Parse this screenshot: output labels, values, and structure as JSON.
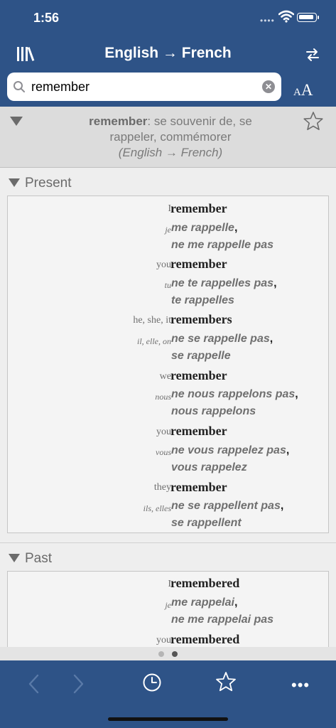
{
  "status": {
    "time": "1:56",
    "signal": "••••"
  },
  "nav": {
    "title": "English → French"
  },
  "search": {
    "value": "remember"
  },
  "font_size_button": {
    "small": "A",
    "large": "A"
  },
  "entry": {
    "word": "remember",
    "line1_rest": ": se souvenir de, se",
    "line2": "rappeler, commémorer",
    "direction": "(English → French)"
  },
  "sections": [
    {
      "label": "Present",
      "rows": [
        {
          "pronoun": "I",
          "english": "remember",
          "fr_pronoun": "je",
          "fr_line1": "me rappelle",
          "fr_line2": "ne me rappelle pas"
        },
        {
          "pronoun": "you",
          "english": "remember",
          "fr_pronoun": "tu",
          "fr_line1": "ne te rappelles pas",
          "fr_line2": "te rappelles"
        },
        {
          "pronoun": "he, she, it",
          "english": "remembers",
          "fr_pronoun": "il, elle, on",
          "fr_line1": "ne se rappelle pas",
          "fr_line2": "se rappelle"
        },
        {
          "pronoun": "we",
          "english": "remember",
          "fr_pronoun": "nous",
          "fr_line1": "ne nous rappelons pas",
          "fr_line2": "nous rappelons"
        },
        {
          "pronoun": "you",
          "english": "remember",
          "fr_pronoun": "vous",
          "fr_line1": "ne vous rappelez pas",
          "fr_line2": "vous rappelez"
        },
        {
          "pronoun": "they",
          "english": "remember",
          "fr_pronoun": "ils, elles",
          "fr_line1": "ne se rappellent pas",
          "fr_line2": "se rappellent"
        }
      ]
    },
    {
      "label": "Past",
      "rows": [
        {
          "pronoun": "I",
          "english": "remembered",
          "fr_pronoun": "je",
          "fr_line1": "me rappelai",
          "fr_line2": "ne me rappelai pas"
        },
        {
          "pronoun": "you",
          "english": "remembered"
        }
      ]
    }
  ],
  "colors": {
    "brand": "#2e5387",
    "background": "#eeeeee"
  },
  "icons": {
    "library": "library-icon",
    "swap": "swap-icon",
    "search": "search-icon",
    "clear": "clear-icon",
    "favorite": "star-icon",
    "back": "chevron-left-icon",
    "forward": "chevron-right-icon",
    "history": "clock-icon",
    "more": "more-icon"
  }
}
